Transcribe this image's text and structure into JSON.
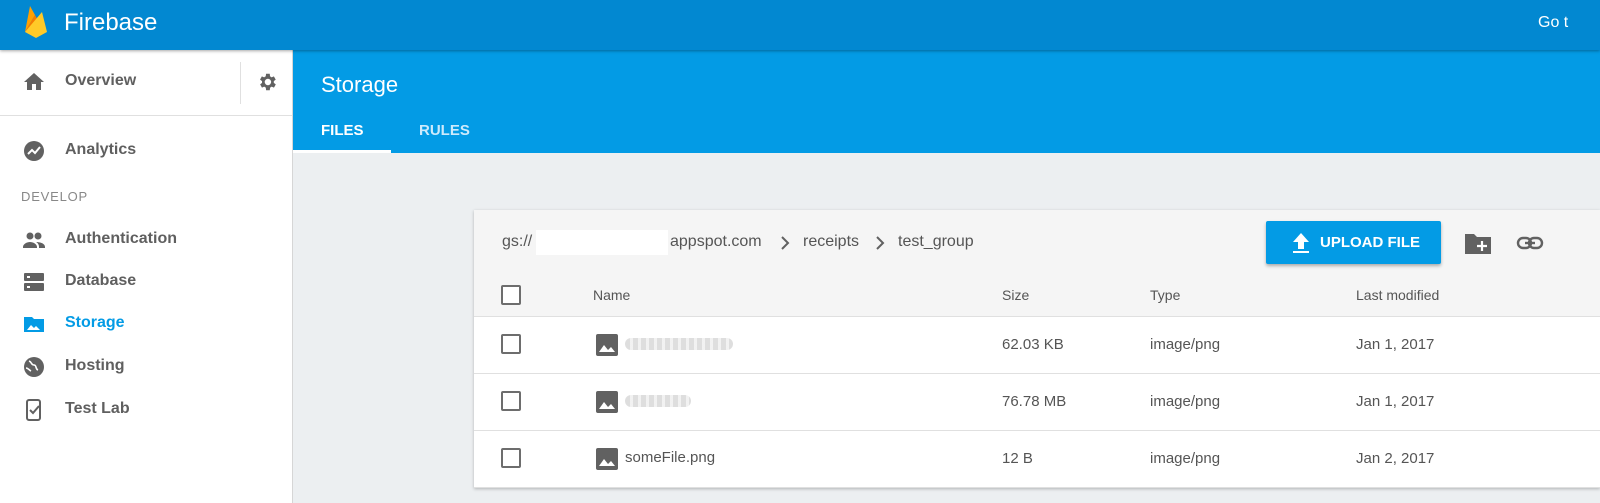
{
  "app": {
    "name": "Firebase",
    "goto_text": "Go t"
  },
  "sidebar": {
    "overview_label": "Overview",
    "analytics_label": "Analytics",
    "section_label": "DEVELOP",
    "items": [
      {
        "label": "Authentication",
        "icon": "people-icon"
      },
      {
        "label": "Database",
        "icon": "database-icon"
      },
      {
        "label": "Storage",
        "icon": "storage-icon",
        "active": true
      },
      {
        "label": "Hosting",
        "icon": "globe-icon"
      },
      {
        "label": "Test Lab",
        "icon": "test-lab-icon"
      }
    ]
  },
  "header": {
    "title": "Storage",
    "tabs": [
      {
        "label": "FILES",
        "active": true
      },
      {
        "label": "RULES"
      }
    ]
  },
  "storage": {
    "breadcrumb": {
      "prefix": "gs://",
      "bucket_suffix": "appspot.com",
      "folders": [
        "receipts",
        "test_group"
      ]
    },
    "upload_label": "UPLOAD FILE",
    "columns": [
      "Name",
      "Size",
      "Type",
      "Last modified"
    ],
    "files": [
      {
        "name": "",
        "size": "62.03 KB",
        "type": "image/png",
        "modified": "Jan 1, 2017"
      },
      {
        "name": "",
        "size": "76.78 MB",
        "type": "image/png",
        "modified": "Jan 1, 2017"
      },
      {
        "name": "someFile.png",
        "size": "12 B",
        "type": "image/png",
        "modified": "Jan 2, 2017"
      }
    ]
  },
  "colors": {
    "topbar": "#0288d1",
    "header": "#039be5",
    "accent": "#039be5",
    "background": "#eceff1"
  }
}
